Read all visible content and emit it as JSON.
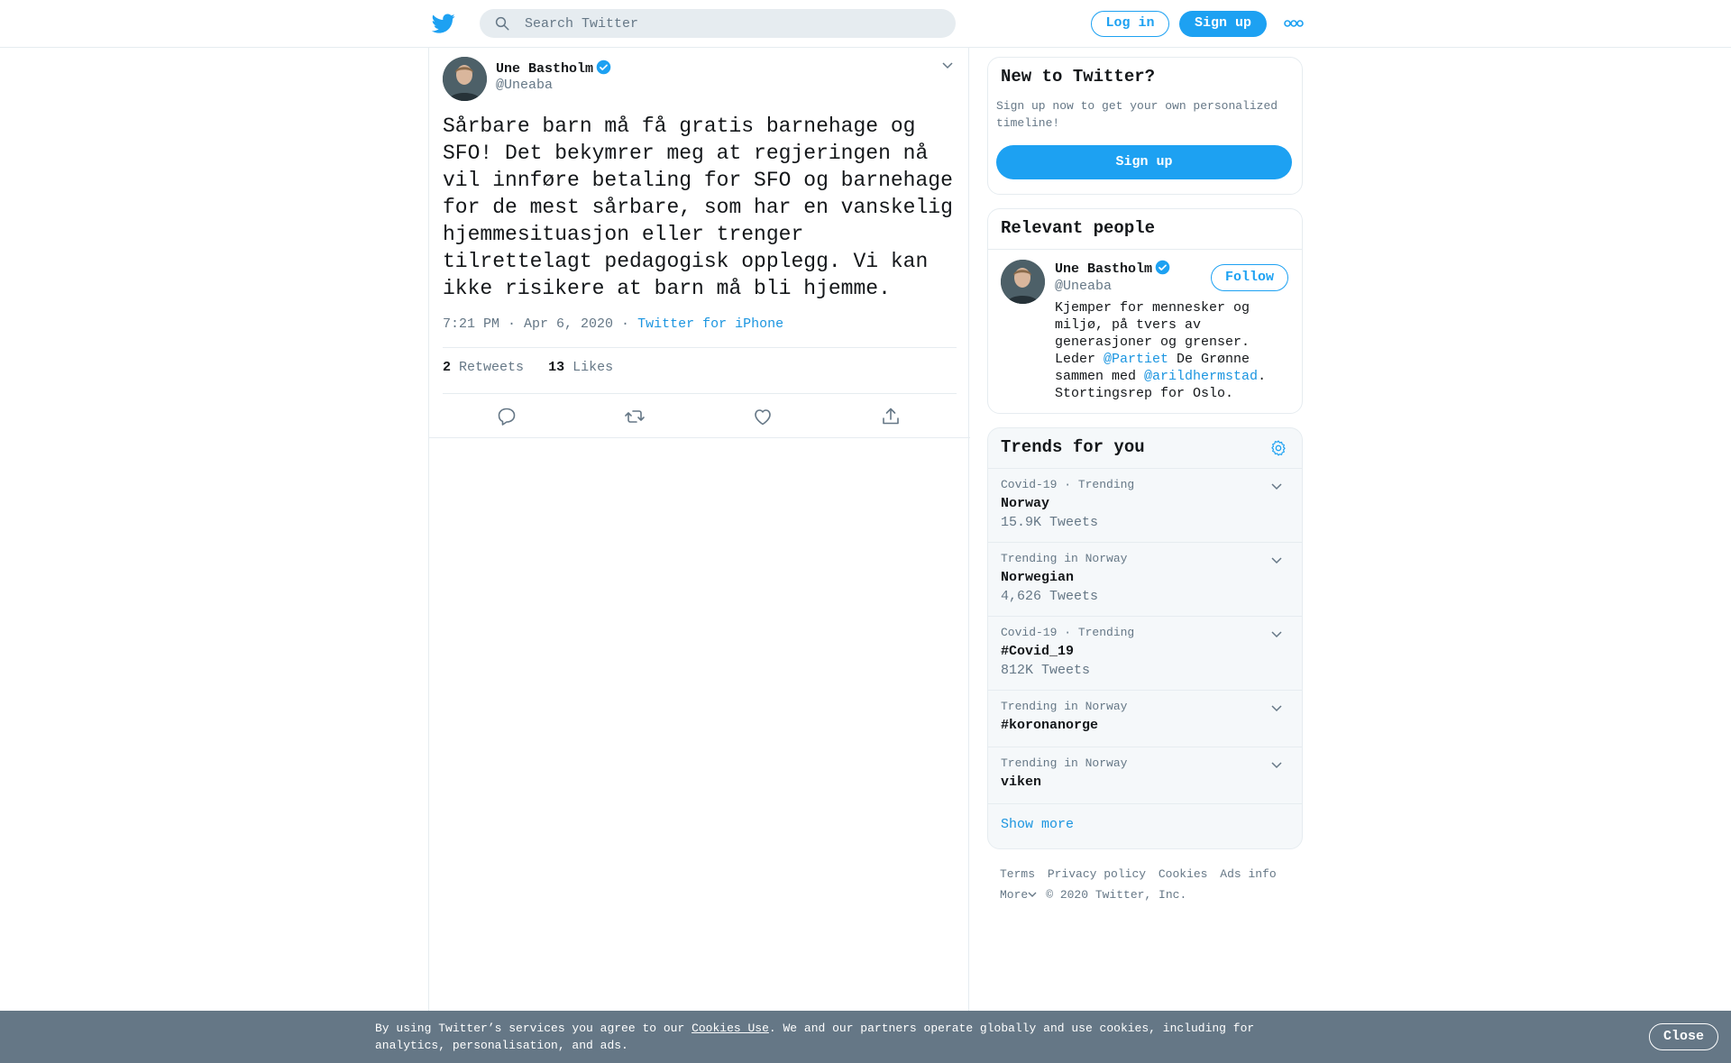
{
  "header": {
    "search_placeholder": "Search Twitter",
    "login_label": "Log in",
    "signup_label": "Sign up",
    "logo_icon": "twitter-bird-icon",
    "more_icon": "more-dots-icon"
  },
  "tweet": {
    "author_name": "Une Bastholm",
    "author_handle": "@Uneaba",
    "text": "Sårbare barn må få gratis barnehage og SFO! Det bekymrer meg at regjeringen nå vil innføre betaling for SFO og barnehage for de mest sårbare, som har en vanskelig hjemmesituasjon eller trenger tilrettelagt pedagogisk opplegg. Vi kan ikke risikere at barn må bli hjemme.",
    "time": "7:21 PM · Apr 6, 2020",
    "dot": "·",
    "source": "Twitter for iPhone",
    "retweets_count": "2",
    "retweets_label": "Retweets",
    "likes_count": "13",
    "likes_label": "Likes",
    "actions": [
      "reply-icon",
      "retweet-icon",
      "like-icon",
      "share-icon"
    ]
  },
  "new_to_twitter": {
    "title": "New to Twitter?",
    "text": "Sign up now to get your own personalized timeline!",
    "button": "Sign up"
  },
  "relevant_people": {
    "title": "Relevant people",
    "name": "Une Bastholm",
    "handle": "@Uneaba",
    "follow_label": "Follow",
    "bio_1": "Kjemper for mennesker og miljø, på tvers av generasjoner og grenser. Leder ",
    "bio_link1": "@Partiet",
    "bio_2": " De Grønne sammen med ",
    "bio_link2": "@arildhermstad",
    "bio_3": ". Stortingsrep for Oslo."
  },
  "trends": {
    "title": "Trends for you",
    "items": [
      {
        "context": "Covid-19 · Trending",
        "name": "Norway",
        "count": "15.9K Tweets"
      },
      {
        "context": "Trending in Norway",
        "name": "Norwegian",
        "count": "4,626 Tweets"
      },
      {
        "context": "Covid-19 · Trending",
        "name": "#Covid_19",
        "count": "812K Tweets"
      },
      {
        "context": "Trending in Norway",
        "name": "#koronanorge",
        "count": ""
      },
      {
        "context": "Trending in Norway",
        "name": "viken",
        "count": ""
      }
    ],
    "show_more": "Show more"
  },
  "footer": {
    "terms": "Terms",
    "privacy": "Privacy policy",
    "cookies": "Cookies",
    "ads": "Ads info",
    "more": "More",
    "copyright": "© 2020 Twitter, Inc."
  },
  "cookie_banner": {
    "text_1": "By using Twitter’s services you agree to our ",
    "link": "Cookies Use",
    "text_2": ". We and our partners operate globally and use cookies, including for analytics, personalisation, and ads.",
    "close": "Close"
  },
  "colors": {
    "brand": "#1da1f2",
    "link": "#1b95e0",
    "muted": "#657786",
    "banner": "#657786"
  }
}
